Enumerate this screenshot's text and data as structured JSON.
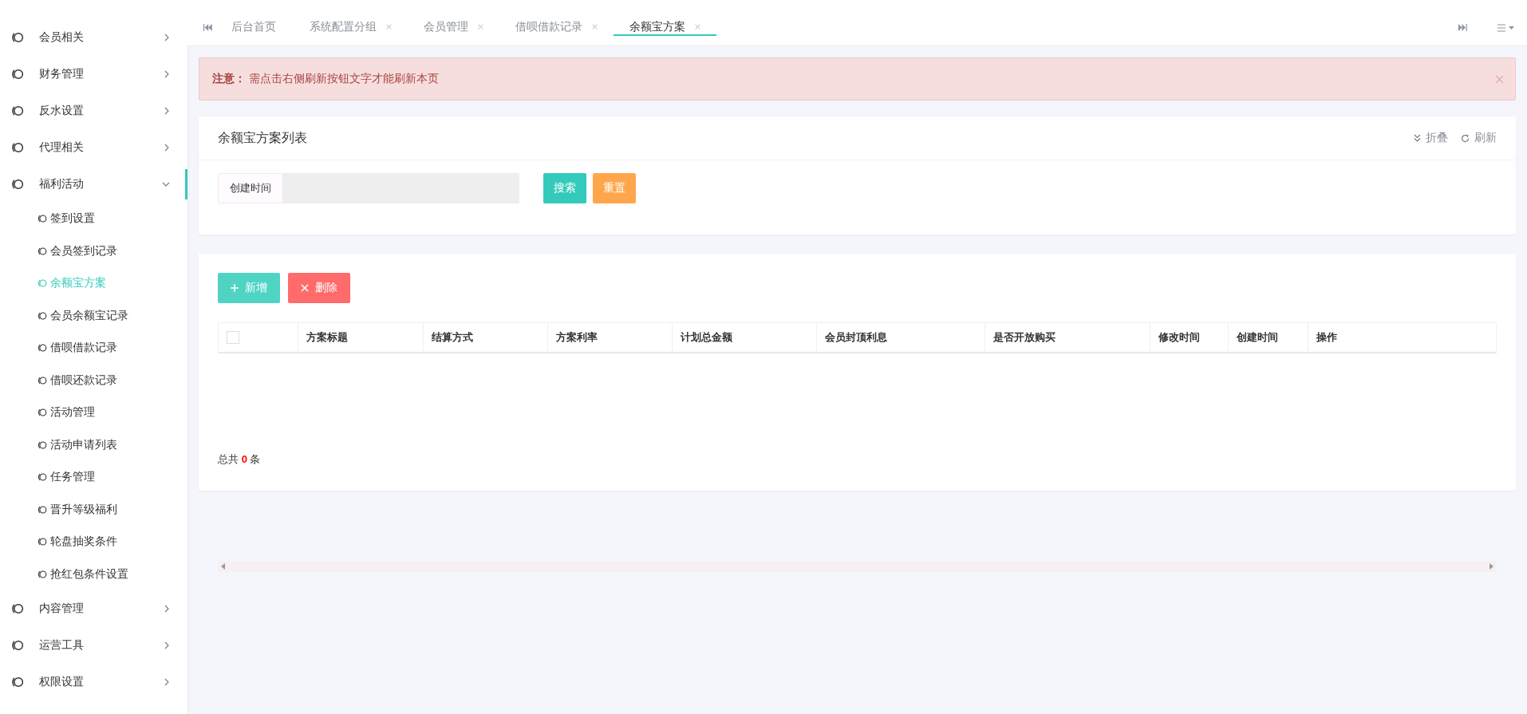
{
  "sidebar": {
    "items": [
      {
        "label": "会员相关",
        "expanded": false
      },
      {
        "label": "财务管理",
        "expanded": false
      },
      {
        "label": "反水设置",
        "expanded": false
      },
      {
        "label": "代理相关",
        "expanded": false
      },
      {
        "label": "福利活动",
        "expanded": true,
        "children": [
          {
            "label": "签到设置",
            "selected": false
          },
          {
            "label": "会员签到记录",
            "selected": false
          },
          {
            "label": "余额宝方案",
            "selected": true
          },
          {
            "label": "会员余额宝记录",
            "selected": false
          },
          {
            "label": "借呗借款记录",
            "selected": false
          },
          {
            "label": "借呗还款记录",
            "selected": false
          },
          {
            "label": "活动管理",
            "selected": false
          },
          {
            "label": "活动申请列表",
            "selected": false
          },
          {
            "label": "任务管理",
            "selected": false
          },
          {
            "label": "晋升等级福利",
            "selected": false
          },
          {
            "label": "轮盘抽奖条件",
            "selected": false
          },
          {
            "label": "抢红包条件设置",
            "selected": false
          }
        ]
      },
      {
        "label": "内容管理",
        "expanded": false
      },
      {
        "label": "运营工具",
        "expanded": false
      },
      {
        "label": "权限设置",
        "expanded": false
      }
    ]
  },
  "tabs": [
    {
      "label": "后台首页",
      "selected": false,
      "closable": false
    },
    {
      "label": "系统配置分组",
      "selected": false,
      "closable": true
    },
    {
      "label": "会员管理",
      "selected": false,
      "closable": true
    },
    {
      "label": "借呗借款记录",
      "selected": false,
      "closable": true
    },
    {
      "label": "余额宝方案",
      "selected": true,
      "closable": true
    }
  ],
  "alert": {
    "text": "**注意：** 需点击右侧刷新按钮文字才能刷新本页"
  },
  "search_panel": {
    "title": "余额宝方案列表",
    "actions": [
      {
        "label": "折叠",
        "kind": "collapse"
      },
      {
        "label": "刷新",
        "kind": "refresh"
      }
    ],
    "filter_label": "创建时间",
    "buttons": [
      {
        "label": "搜索",
        "kind": "search"
      },
      {
        "label": "重置",
        "kind": "reset"
      }
    ]
  },
  "toolbar": [
    {
      "label": "新增",
      "kind": "add"
    },
    {
      "label": "删除",
      "kind": "delete"
    }
  ],
  "table": {
    "select_all": {
      "checked": false
    },
    "columns": [
      "方案标题",
      "结算方式",
      "方案利率",
      "计划总金额",
      "会员封顶利息",
      "是否开放购买",
      "修改时间",
      "创建时间",
      "操作"
    ]
  },
  "total": "总共 **0** 条"
}
